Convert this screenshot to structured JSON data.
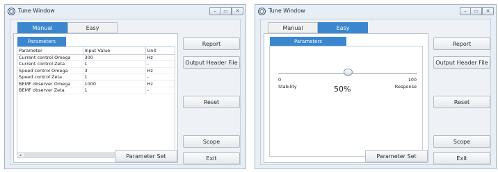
{
  "window_title": "Tune Window",
  "window_controls": {
    "minimize": "–",
    "maximize": "▭",
    "close": "✕"
  },
  "tabs": {
    "manual": "Manual",
    "easy": "Easy"
  },
  "manual_view": {
    "subtab": "Parameters",
    "table": {
      "columns": [
        "Parameter",
        "Input Value",
        "Unit"
      ],
      "rows": [
        [
          "Current control Omega",
          "300",
          "Hz"
        ],
        [
          "Current control Zeta",
          "1",
          "-"
        ],
        [
          "Speed control Omega",
          "3",
          "Hz"
        ],
        [
          "Speed control Zeta",
          "1",
          "-"
        ],
        [
          "BEMF observer Omega",
          "1000",
          "Hz"
        ],
        [
          "BEMF observer Zeta",
          "1",
          "-"
        ]
      ]
    },
    "scroll_left": "◂",
    "scroll_right": "▸",
    "parameter_set_button": "Parameter Set"
  },
  "easy_view": {
    "subtab": "Parameters",
    "slider": {
      "min_label": "0",
      "max_label": "100",
      "left_label": "Stability",
      "right_label": "Response",
      "value_text": "50%",
      "level_fraction": 0.5
    },
    "parameter_set_button": "Parameter Set"
  },
  "side_buttons": {
    "report": "Report",
    "output_header_file": "Output Header File",
    "reset": "Reset",
    "scope": "Scope",
    "exit": "Exit"
  },
  "colors": {
    "accent": "#3a87cf",
    "window_bg": "#e7eef6"
  }
}
